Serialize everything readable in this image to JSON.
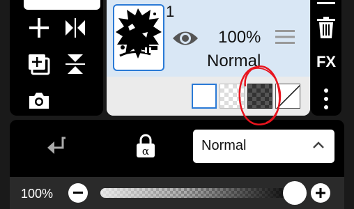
{
  "layer": {
    "number": "1",
    "opacity": "100%",
    "blend_mode": "Normal"
  },
  "right_toolbar": {
    "fx_label": "FX"
  },
  "blend_dropdown": {
    "selected": "Normal"
  },
  "opacity_slider": {
    "label": "100%",
    "value": 1.0
  },
  "icons": {
    "tools": [
      "plus-icon",
      "flip-horizontal-icon",
      "add-layer-icon",
      "flip-vertical-icon",
      "camera-icon"
    ],
    "layer": [
      "visibility-eye-icon",
      "drag-handle-icon"
    ],
    "right_toolbar": [
      "menu-icon",
      "trash-icon",
      "more-vertical-icon"
    ],
    "bottom": [
      "merge-down-arrow-icon",
      "alpha-lock-icon",
      "chevron-up-icon",
      "minus-icon",
      "plus-icon"
    ]
  },
  "colors": {
    "selection_blue": "#2a7ad6",
    "layer_row_bg": "#d9e7f5",
    "annotation_red": "#e8141e"
  }
}
